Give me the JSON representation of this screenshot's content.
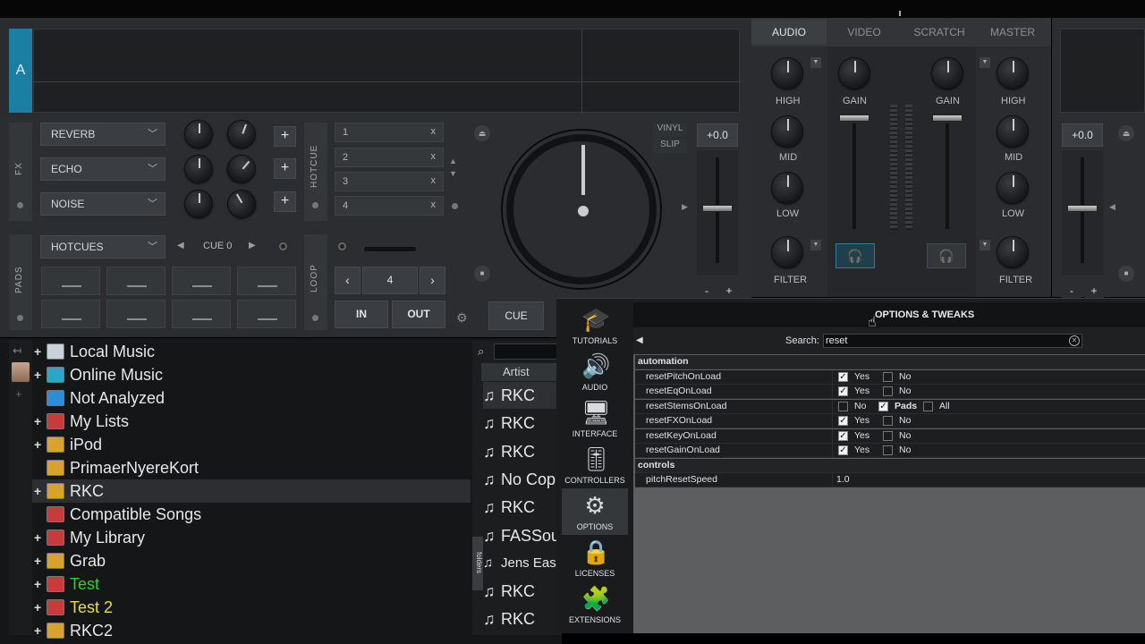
{
  "deck_a": {
    "letter": "A",
    "fx": {
      "label": "FX",
      "effects": [
        "REVERB",
        "ECHO",
        "NOISE"
      ],
      "add_symbol": "+"
    },
    "hotcue": {
      "label": "HOTCUE",
      "slots": [
        "1",
        "2",
        "3",
        "4"
      ],
      "clear_symbol": "x"
    },
    "pads": {
      "label": "PADS",
      "mode": "HOTCUES",
      "page": "CUE 0"
    },
    "loop": {
      "label": "LOOP",
      "size": "4",
      "in_label": "IN",
      "out_label": "OUT"
    },
    "vinyl_label": "VINYL",
    "slip_label": "SLIP",
    "pitch": "+0.0",
    "cue_label": "CUE",
    "minus": "-",
    "plus": "+"
  },
  "mixer": {
    "tabs": [
      "AUDIO",
      "VIDEO",
      "SCRATCH",
      "MASTER"
    ],
    "active_tab": "AUDIO",
    "eq_labels": [
      "HIGH",
      "MID",
      "LOW",
      "FILTER"
    ],
    "gain_label": "GAIN"
  },
  "deck_b": {
    "pitch": "+0.0",
    "minus": "-",
    "plus": "+"
  },
  "browser": {
    "folders": [
      {
        "label": "Local Music",
        "plus": "+",
        "color": "#e8e8e8",
        "icon_color": "#c9d2da"
      },
      {
        "label": "Online Music",
        "plus": "+",
        "color": "#e8e8e8",
        "icon_color": "#2aa6c9"
      },
      {
        "label": "Not Analyzed",
        "plus": "",
        "color": "#e8e8e8",
        "icon_color": "#2a8fd6"
      },
      {
        "label": "My Lists",
        "plus": "+",
        "color": "#e8e8e8",
        "icon_color": "#c93a3a"
      },
      {
        "label": "iPod",
        "plus": "+",
        "color": "#e8e8e8",
        "icon_color": "#d9a22a"
      },
      {
        "label": "PrimaerNyereKort",
        "plus": "",
        "color": "#e8e8e8",
        "icon_color": "#d9a22a"
      },
      {
        "label": "RKC",
        "plus": "+",
        "color": "#e8e8e8",
        "icon_color": "#d9a22a"
      },
      {
        "label": "Compatible Songs",
        "plus": "",
        "color": "#e8e8e8",
        "icon_color": "#c93a3a"
      },
      {
        "label": "My Library",
        "plus": "+",
        "color": "#e8e8e8",
        "icon_color": "#c93a3a"
      },
      {
        "label": "Grab",
        "plus": "+",
        "color": "#e8e8e8",
        "icon_color": "#d9a22a"
      },
      {
        "label": "Test",
        "plus": "+",
        "color": "#2fd12f",
        "icon_color": "#c93a3a"
      },
      {
        "label": "Test 2",
        "plus": "+",
        "color": "#e6e04a",
        "icon_color": "#c93a3a"
      },
      {
        "label": "RKC2",
        "plus": "+",
        "color": "#e8e8e8",
        "icon_color": "#d9a22a"
      }
    ],
    "selected_folder": "RKC",
    "column_artist": "Artist",
    "tracks": [
      "RKC",
      "RKC",
      "RKC",
      "No Cop",
      "RKC",
      "FASSou",
      "Jens East",
      "RKC",
      "RKC"
    ],
    "folders_tab": "folders"
  },
  "options_dialog": {
    "title": "OPTIONS & TWEAKS",
    "search_label": "Search:",
    "search_value": "reset",
    "sidebar": [
      "TUTORIALS",
      "AUDIO",
      "INTERFACE",
      "CONTROLLERS",
      "OPTIONS",
      "LICENSES",
      "EXTENSIONS"
    ],
    "active_sidebar": "OPTIONS",
    "groups": [
      {
        "name": "automation",
        "rows": [
          {
            "key": "resetPitchOnLoad",
            "options": [
              {
                "label": "Yes",
                "checked": true
              },
              {
                "label": "No",
                "checked": false
              }
            ]
          },
          {
            "key": "resetEqOnLoad",
            "options": [
              {
                "label": "Yes",
                "checked": true
              },
              {
                "label": "No",
                "checked": false
              }
            ]
          },
          {
            "key": "resetStemsOnLoad",
            "options": [
              {
                "label": "No",
                "checked": false
              },
              {
                "label": "Pads",
                "checked": true
              },
              {
                "label": "All",
                "checked": false
              }
            ]
          },
          {
            "key": "resetFXOnLoad",
            "options": [
              {
                "label": "Yes",
                "checked": true
              },
              {
                "label": "No",
                "checked": false
              }
            ]
          },
          {
            "key": "resetKeyOnLoad",
            "options": [
              {
                "label": "Yes",
                "checked": true
              },
              {
                "label": "No",
                "checked": false
              }
            ]
          },
          {
            "key": "resetGainOnLoad",
            "options": [
              {
                "label": "Yes",
                "checked": true
              },
              {
                "label": "No",
                "checked": false
              }
            ]
          }
        ]
      },
      {
        "name": "controls",
        "rows": [
          {
            "key": "pitchResetSpeed",
            "value": "1.0"
          }
        ]
      }
    ]
  },
  "colors": {
    "accent": "#1b7fa3",
    "panel": "#2b2d30",
    "dialog_bg": "#5c5e60"
  }
}
